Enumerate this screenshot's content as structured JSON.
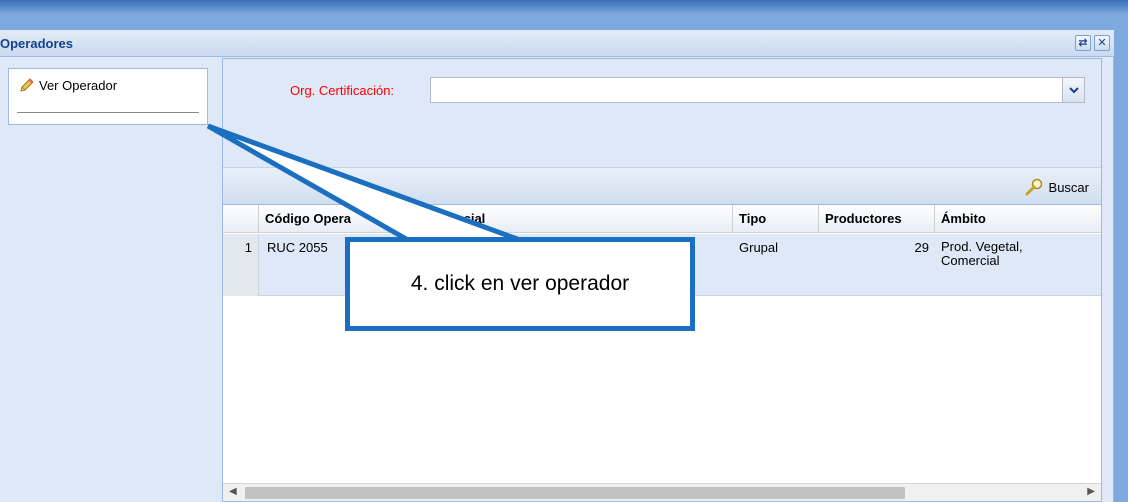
{
  "window": {
    "title": "Operadores",
    "tools": [
      {
        "name": "refresh-icon",
        "glyph": "⇄"
      },
      {
        "name": "close-icon",
        "glyph": "✕"
      }
    ]
  },
  "left_panel": {
    "action_label": "Ver Operador",
    "action_icon": "pencil-icon"
  },
  "form": {
    "org_label": "Org. Certificación:",
    "org_value": ""
  },
  "toolbar": {
    "search_label": "Buscar",
    "search_icon": "magnifier-icon"
  },
  "grid": {
    "columns": [
      "",
      "Código Opera",
      "zón Social",
      "Tipo",
      "Productores",
      "Ámbito"
    ],
    "rows": [
      {
        "num": "1",
        "codigo": "RUC 2055",
        "razon": "",
        "tipo": "Grupal",
        "productores": "29",
        "ambito_line1": "Prod. Vegetal,",
        "ambito_line2": "Comercial"
      }
    ]
  },
  "annotation": {
    "text": "4. click en ver operador",
    "color": "#1a6fc0"
  },
  "colors": {
    "title_text": "#15428b",
    "required_label": "#ff0000",
    "panel_bg": "#dfe8f6",
    "border": "#99bbe8"
  }
}
